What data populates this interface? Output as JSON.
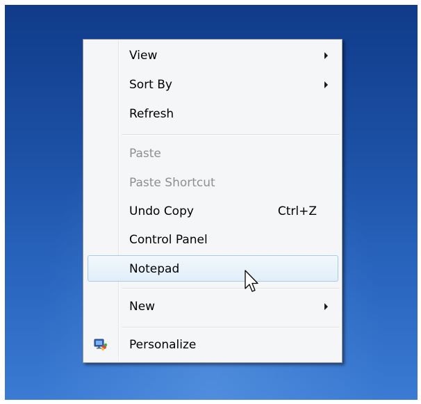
{
  "context_menu": {
    "items": [
      {
        "label": "View",
        "submenu": true,
        "enabled": true
      },
      {
        "label": "Sort By",
        "submenu": true,
        "enabled": true
      },
      {
        "label": "Refresh",
        "submenu": false,
        "enabled": true
      },
      {
        "label": "Paste",
        "submenu": false,
        "enabled": false
      },
      {
        "label": "Paste Shortcut",
        "submenu": false,
        "enabled": false
      },
      {
        "label": "Undo Copy",
        "shortcut": "Ctrl+Z",
        "submenu": false,
        "enabled": true
      },
      {
        "label": "Control Panel",
        "submenu": false,
        "enabled": true
      },
      {
        "label": "Notepad",
        "submenu": false,
        "enabled": true,
        "highlighted": true
      },
      {
        "label": "New",
        "submenu": true,
        "enabled": true
      },
      {
        "label": "Personalize",
        "icon": "personalize-icon",
        "submenu": false,
        "enabled": true
      }
    ]
  },
  "colors": {
    "desktop_background": "#1b4fa3",
    "menu_background": "#f5f6f7",
    "highlight_border": "#a9cbe8",
    "disabled_text": "#8f8f8f"
  },
  "cursor": {
    "icon": "arrow-pointer-icon"
  }
}
